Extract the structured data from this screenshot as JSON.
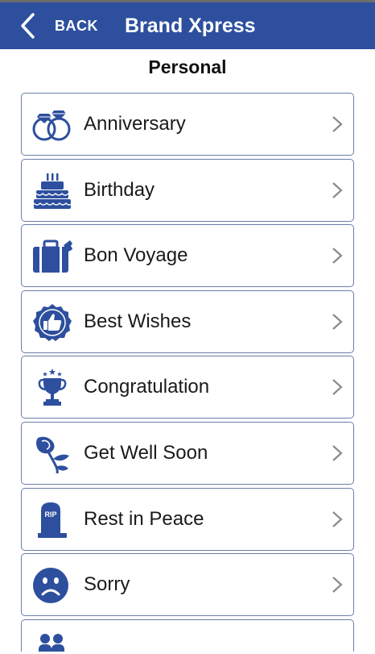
{
  "header": {
    "back_label": "BACK",
    "title": "Brand Xpress"
  },
  "section": {
    "title": "Personal"
  },
  "items": [
    {
      "label": "Anniversary",
      "icon": "rings-icon"
    },
    {
      "label": "Birthday",
      "icon": "cake-icon"
    },
    {
      "label": "Bon Voyage",
      "icon": "suitcase-icon"
    },
    {
      "label": "Best Wishes",
      "icon": "thumbs-up-badge-icon"
    },
    {
      "label": "Congratulation",
      "icon": "trophy-icon"
    },
    {
      "label": "Get Well Soon",
      "icon": "rose-icon"
    },
    {
      "label": "Rest in Peace",
      "icon": "tombstone-icon",
      "icon_text": "RIP"
    },
    {
      "label": "Sorry",
      "icon": "sad-face-icon"
    }
  ],
  "colors": {
    "appbar": "#2d4f9e",
    "icon": "#2d4f9e",
    "border": "#6b7ea8",
    "chevron": "#8a8a8a"
  }
}
